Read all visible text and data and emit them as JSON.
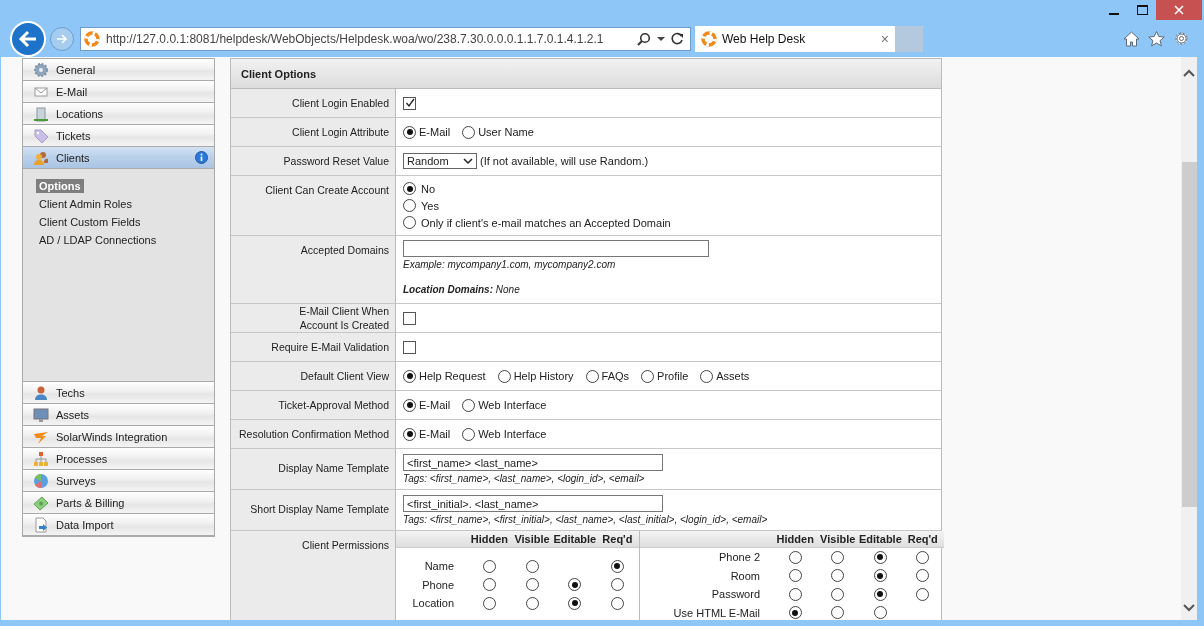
{
  "browser": {
    "url": "http://127.0.0.1:8081/helpdesk/WebObjects/Helpdesk.woa/wo/238.7.30.0.0.0.1.1.7.0.1.4.1.2.1",
    "tab_title": "Web Help Desk",
    "tab_close": "×"
  },
  "sidebar": {
    "items": [
      {
        "label": "General",
        "selected": false
      },
      {
        "label": "E-Mail",
        "selected": false
      },
      {
        "label": "Locations",
        "selected": false
      },
      {
        "label": "Tickets",
        "selected": false
      },
      {
        "label": "Clients",
        "selected": true,
        "info": true,
        "children": [
          {
            "label": "Options",
            "selected": true
          },
          {
            "label": "Client Admin Roles",
            "selected": false
          },
          {
            "label": "Client Custom Fields",
            "selected": false
          },
          {
            "label": "AD / LDAP Connections",
            "selected": false
          }
        ]
      },
      {
        "label": "Techs",
        "selected": false
      },
      {
        "label": "Assets",
        "selected": false
      },
      {
        "label": "SolarWinds Integration",
        "selected": false
      },
      {
        "label": "Processes",
        "selected": false
      },
      {
        "label": "Surveys",
        "selected": false
      },
      {
        "label": "Parts & Billing",
        "selected": false
      },
      {
        "label": "Data Import",
        "selected": false
      }
    ]
  },
  "panel": {
    "title": "Client Options",
    "rows": [
      {
        "label": "Client Login Enabled",
        "kind": "checkbox",
        "checked": true
      },
      {
        "label": "Client Login Attribute",
        "kind": "radios",
        "options": [
          {
            "label": "E-Mail",
            "selected": true
          },
          {
            "label": "User Name",
            "selected": false
          }
        ]
      },
      {
        "label": "Password Reset Value",
        "kind": "select",
        "value": "Random",
        "note": "(If not available, will use Random.)"
      },
      {
        "label": "Client Can Create Account",
        "kind": "radio_stack",
        "options": [
          {
            "label": "No",
            "selected": true
          },
          {
            "label": "Yes",
            "selected": false
          },
          {
            "label": "Only if client's e-mail matches an Accepted Domain",
            "selected": false
          }
        ]
      },
      {
        "label": "Accepted Domains",
        "kind": "text",
        "hint": "Example: mycompany1.com, mycompany2.com",
        "extra": "**Location Domains:** None"
      },
      {
        "label_lines": [
          "E-Mail Client When",
          "Account Is Created"
        ],
        "kind": "checkbox",
        "checked": false
      },
      {
        "label": "Require E-Mail Validation",
        "kind": "checkbox",
        "checked": false
      },
      {
        "label": "Default Client View",
        "kind": "radios",
        "options": [
          {
            "label": "Help Request",
            "selected": true
          },
          {
            "label": "Help History",
            "selected": false
          },
          {
            "label": "FAQs",
            "selected": false
          },
          {
            "label": "Profile",
            "selected": false
          },
          {
            "label": "Assets",
            "selected": false
          }
        ]
      },
      {
        "label": "Ticket-Approval Method",
        "kind": "radios",
        "options": [
          {
            "label": "E-Mail",
            "selected": true
          },
          {
            "label": "Web Interface",
            "selected": false
          }
        ]
      },
      {
        "label": "Resolution Confirmation Method",
        "kind": "radios",
        "options": [
          {
            "label": "E-Mail",
            "selected": true
          },
          {
            "label": "Web Interface",
            "selected": false
          }
        ]
      },
      {
        "label": "Display Name Template",
        "kind": "template",
        "value": "<first_name> <last_name>",
        "tags": "Tags: <first_name>, <last_name>, <login_id>, <email>"
      },
      {
        "label": "Short Display Name Template",
        "kind": "template",
        "value": "<first_initial>. <last_name>",
        "tags": "Tags: <first_name>, <first_initial>, <last_name>, <last_initial>, <login_id>, <email>"
      },
      {
        "label": "Client Permissions",
        "kind": "permissions",
        "columns": [
          "Hidden",
          "Visible",
          "Editable",
          "Req'd"
        ],
        "left": [
          {
            "label": "Name",
            "cells": [
              {
                "kind": "radio",
                "selected": false
              },
              {
                "kind": "radio",
                "selected": false
              },
              {
                "kind": "blank"
              },
              {
                "kind": "radio",
                "selected": true
              }
            ]
          },
          {
            "label": "Phone",
            "cells": [
              {
                "kind": "radio",
                "selected": false
              },
              {
                "kind": "radio",
                "selected": false
              },
              {
                "kind": "radio",
                "selected": true
              },
              {
                "kind": "radio",
                "selected": false
              }
            ]
          },
          {
            "label": "Location",
            "cells": [
              {
                "kind": "radio",
                "selected": false
              },
              {
                "kind": "radio",
                "selected": false
              },
              {
                "kind": "radio",
                "selected": true
              },
              {
                "kind": "radio",
                "selected": false
              }
            ]
          }
        ],
        "right_columns": [
          "Hidden",
          "Visible",
          "Editable",
          "Req'd"
        ],
        "right": [
          {
            "label": "Phone 2",
            "cells": [
              {
                "kind": "radio",
                "selected": false
              },
              {
                "kind": "radio",
                "selected": false
              },
              {
                "kind": "radio",
                "selected": true
              },
              {
                "kind": "radio",
                "selected": false
              }
            ]
          },
          {
            "label": "Room",
            "cells": [
              {
                "kind": "radio",
                "selected": false
              },
              {
                "kind": "radio",
                "selected": false
              },
              {
                "kind": "radio",
                "selected": true
              },
              {
                "kind": "radio",
                "selected": false
              }
            ]
          },
          {
            "label": "Password",
            "cells": [
              {
                "kind": "radio",
                "selected": false
              },
              {
                "kind": "radio",
                "selected": false
              },
              {
                "kind": "radio",
                "selected": true
              },
              {
                "kind": "radio",
                "selected": false
              }
            ]
          },
          {
            "label": "Use HTML E-Mail",
            "cells": [
              {
                "kind": "radio",
                "selected": true
              },
              {
                "kind": "radio",
                "selected": false
              },
              {
                "kind": "radio",
                "selected": false
              }
            ]
          }
        ]
      }
    ]
  }
}
